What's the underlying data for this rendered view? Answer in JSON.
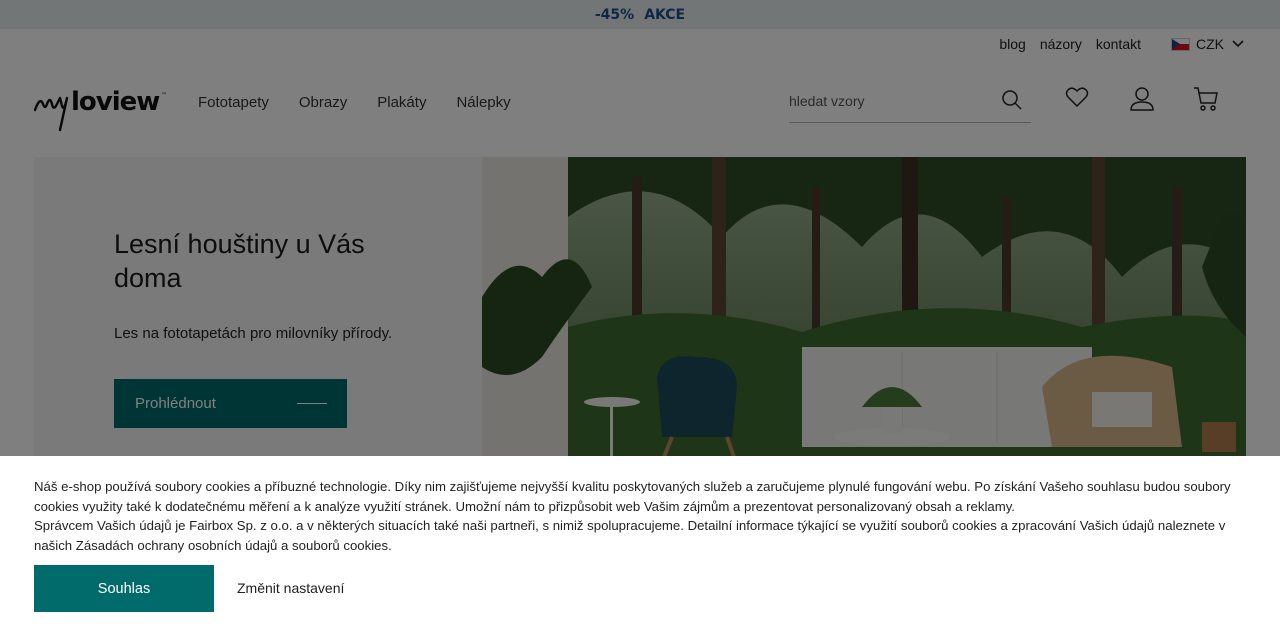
{
  "promo": {
    "discount": "-45%",
    "label": "AKCE"
  },
  "util_nav": {
    "blog": "blog",
    "reviews": "názory",
    "contact": "kontakt",
    "currency": "CZK"
  },
  "header": {
    "nav": [
      "Fototapety",
      "Obrazy",
      "Plakáty",
      "Nálepky"
    ],
    "search_placeholder": "hledat vzory"
  },
  "hero": {
    "title": "Lesní houštiny u Vás doma",
    "subtitle": "Les na fototapetách pro milovníky přírody.",
    "button": "Prohlédnout"
  },
  "cookie": {
    "paragraph1": "Náš e-shop používá soubory cookies a příbuzné technologie. Díky nim zajišťujeme nejvyšší kvalitu poskytovaných služeb a zaručujeme plynulé fungování webu. Po získání Vašeho souhlasu budou soubory cookies využity také k dodatečnému měření a k analýze využití stránek. Umožní nám to přizpůsobit web Vašim zájmům a prezentovat personalizovaný obsah a reklamy.",
    "paragraph2": "Správcem Vašich údajů je Fairbox Sp. z o.o. a v některých situacích také naši partneři, s nimiž spolupracujeme. Detailní informace týkající se využití souborů cookies a zpracování Vašich údajů naleznete v našich Zásadách ochrany osobních údajů a souborů cookies.",
    "agree": "Souhlas",
    "settings": "Změnit nastavení"
  },
  "colors": {
    "accent": "#006b6a",
    "promo_text": "#1c4e8a",
    "promo_bg": "#e6ecee"
  }
}
